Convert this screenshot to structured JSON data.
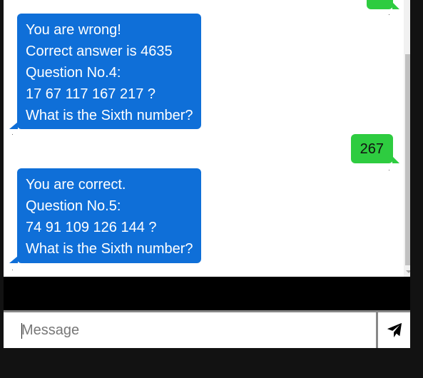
{
  "chat": {
    "messages": [
      {
        "from": "user",
        "lines": [
          ""
        ]
      },
      {
        "from": "bot",
        "lines": [
          "You are wrong!",
          "Correct answer is 4635",
          "Question No.4:",
          "17 67 117 167 217 ?",
          "What is the Sixth number?"
        ]
      },
      {
        "from": "user",
        "lines": [
          "267"
        ]
      },
      {
        "from": "bot",
        "lines": [
          "You are correct.",
          "Question No.5:",
          "74 91 109 126 144 ?",
          "What is the Sixth number?"
        ]
      }
    ]
  },
  "composer": {
    "placeholder": "Message",
    "send_icon": "send-icon"
  },
  "colors": {
    "bot_bubble": "#0f6fd8",
    "user_bubble": "#2ecc40",
    "background": "#121212"
  }
}
